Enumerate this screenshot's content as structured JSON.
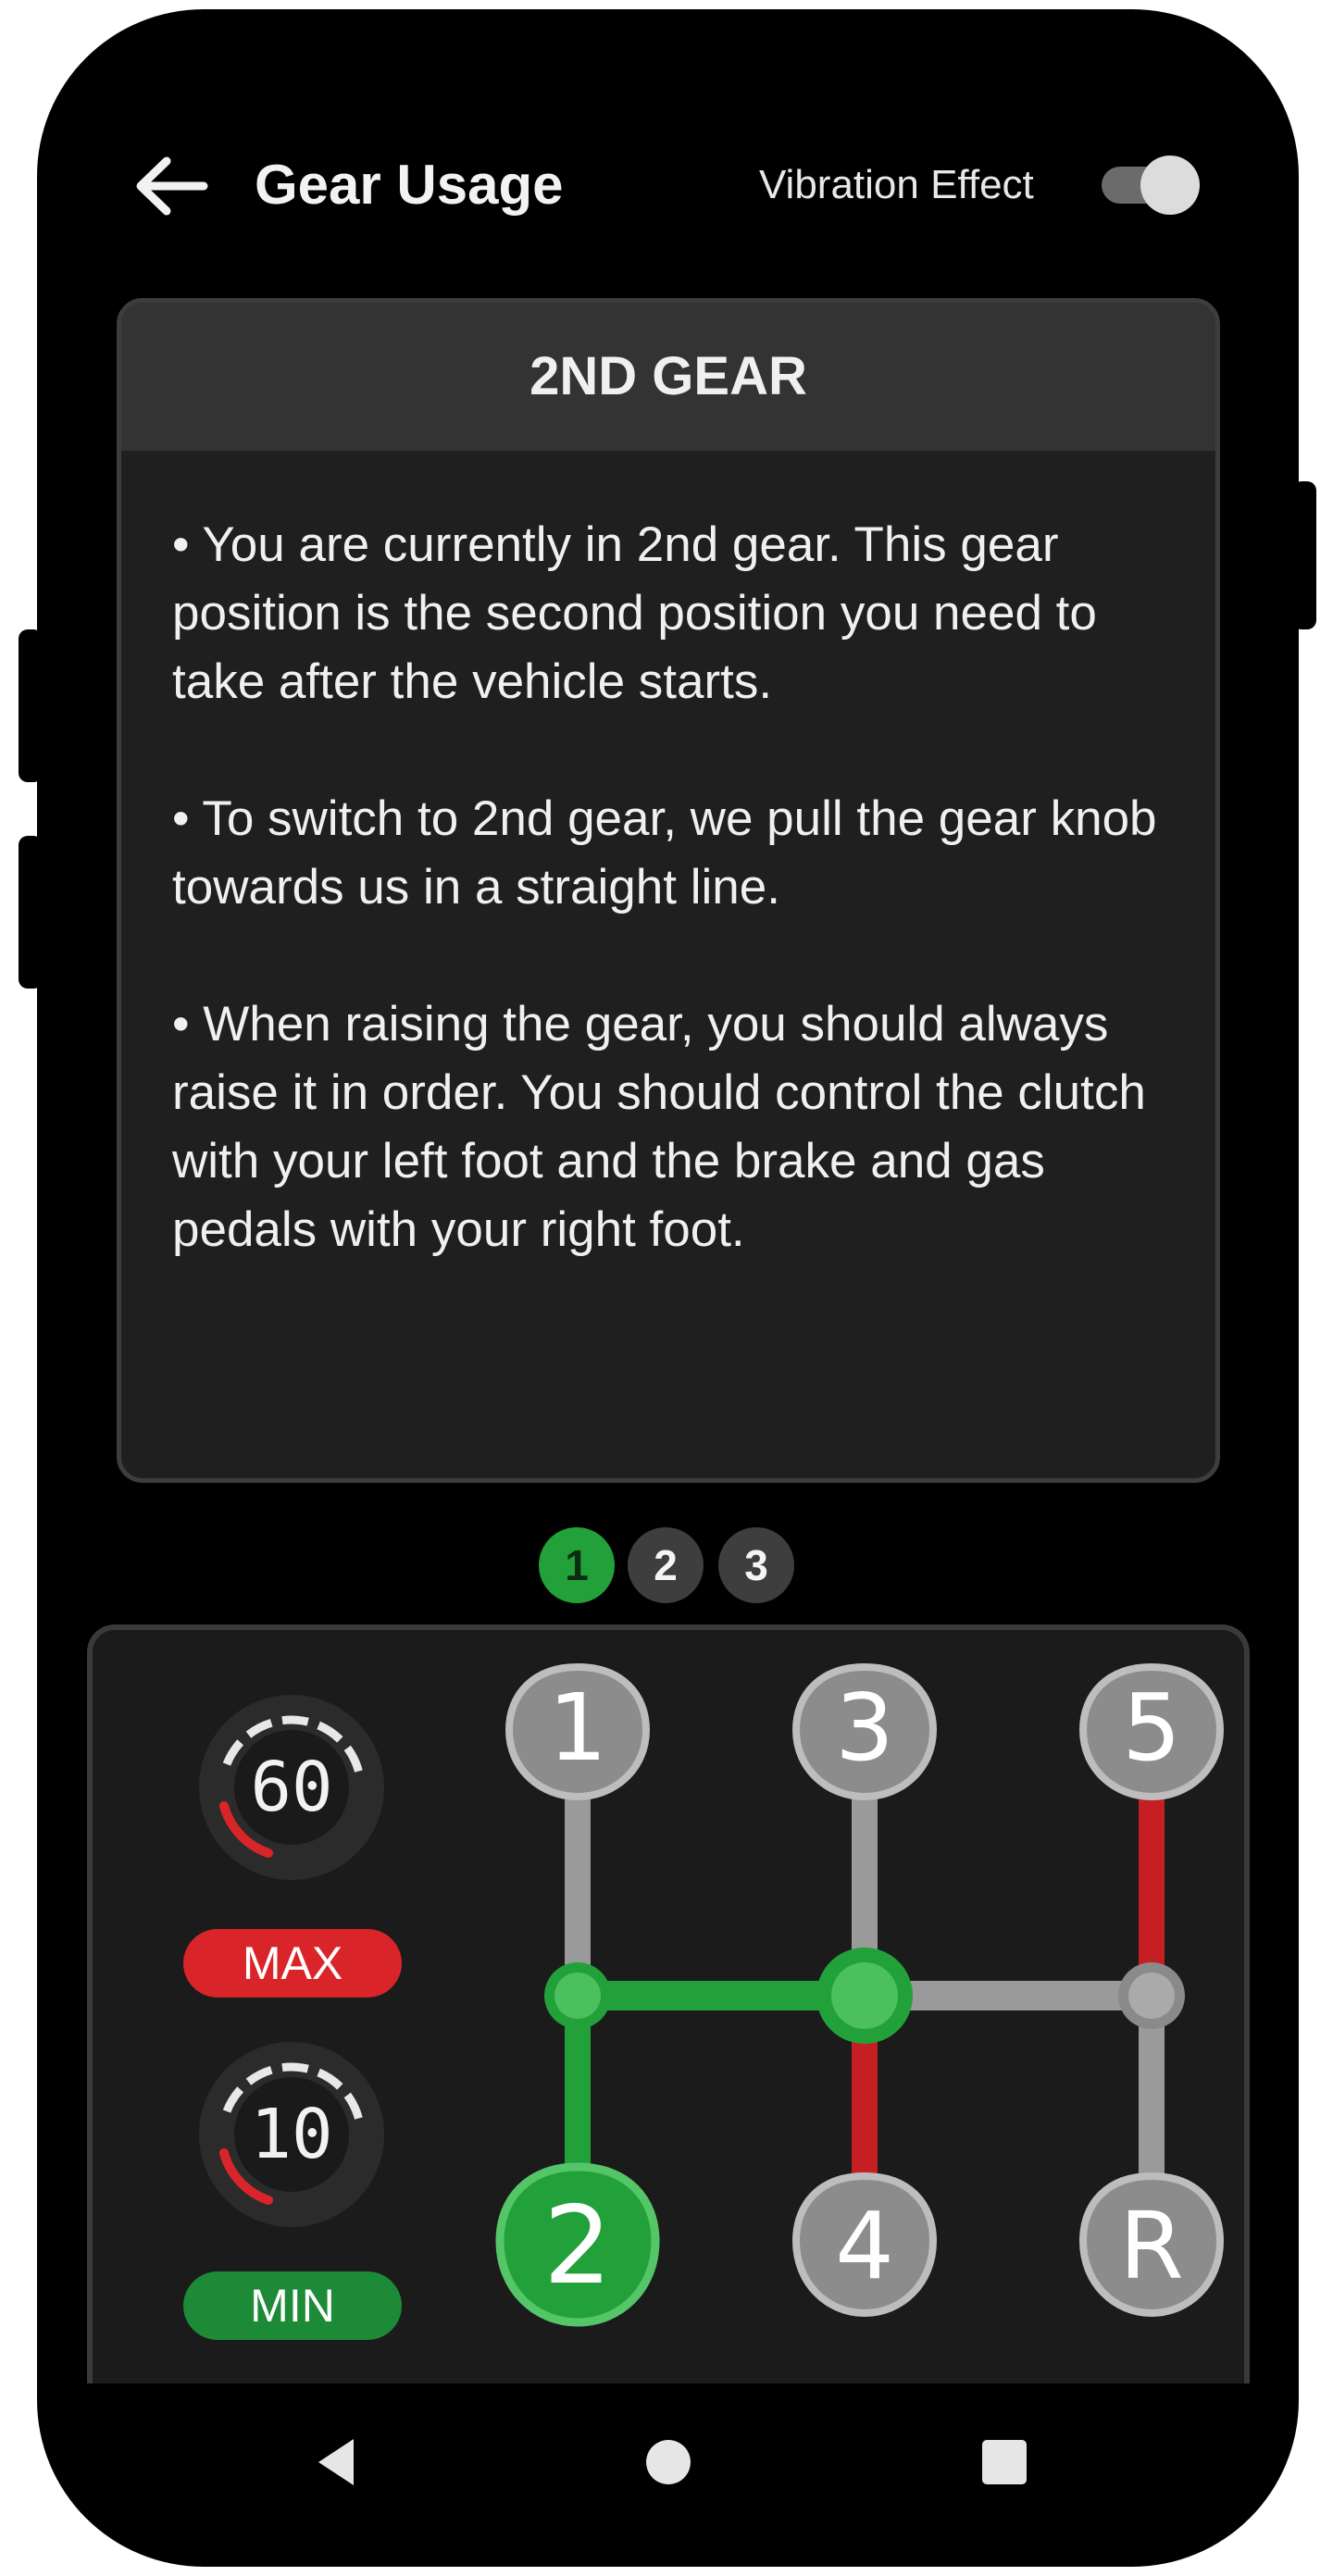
{
  "header": {
    "title": "Gear Usage",
    "back_icon": "arrow-left-icon",
    "vibration_label": "Vibration Effect",
    "vibration_on": true
  },
  "card": {
    "title": "2ND GEAR",
    "paragraphs": [
      "• You are currently in 2nd gear. This gear position is the second position you need to take after the vehicle starts.",
      "• To switch to 2nd gear, we pull the gear knob towards us in a straight line.",
      "• When raising the gear, you should always raise it in order. You should control the clutch with your left foot and the brake and gas pedals with your right foot."
    ]
  },
  "pager": {
    "pages": [
      "1",
      "2",
      "3"
    ],
    "active_index": 0
  },
  "speed": {
    "max_value": "60",
    "max_label": "MAX",
    "min_value": "10",
    "min_label": "MIN"
  },
  "shifter": {
    "gears": [
      "1",
      "2",
      "3",
      "4",
      "5",
      "R"
    ],
    "active_gear": "2",
    "colors": {
      "active": "#22a13a",
      "inactive": "#8a8a8a",
      "warning": "#c51f24"
    }
  },
  "nav": {
    "back_icon": "nav-back-triangle-icon",
    "home_icon": "nav-home-circle-icon",
    "recents_icon": "nav-recents-square-icon"
  }
}
